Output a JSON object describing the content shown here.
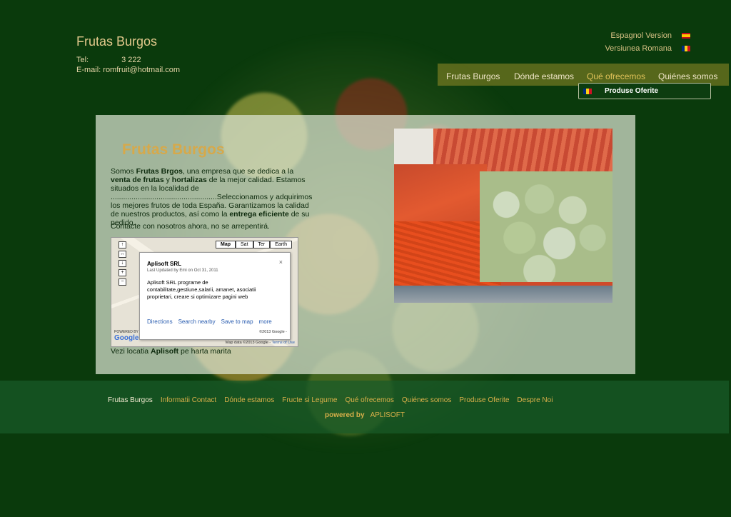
{
  "header": {
    "brand": "Frutas Burgos",
    "tel_label": "Tel:",
    "tel_number": "3 222",
    "email": "E-mail: romfruit@hotmail.com"
  },
  "languages": [
    {
      "label": "Espagnol Version",
      "flag": "spain-flag-icon"
    },
    {
      "label": "Versiunea Romana",
      "flag": "romania-flag-icon"
    }
  ],
  "nav": {
    "items": [
      "Frutas Burgos",
      "Dónde estamos",
      "Qué ofrecemos",
      "Quiénes somos"
    ],
    "active_index": 2,
    "submenu_item": "Produse Oferite"
  },
  "main": {
    "title": "Frutas Burgos",
    "desc_1": "Somos ",
    "desc_brand": "Frutas Brgos",
    "desc_2": ", una empresa  que se dedica a la ",
    "desc_b1": "venta de frutas",
    "desc_3": " y ",
    "desc_b2": "hortalizas",
    "desc_4": " de la mejor calidad. Estamos situados en la localidad de ...................................................Seleccionamos y adquirimos los mejores frutos de toda España. Garantizamos la calidad de nuestros productos, así como la ",
    "desc_b3": "entrega eficiente",
    "desc_5": " de su pedido.",
    "cta": "Contacte con nosotros ahora, no se arrepentirá."
  },
  "map": {
    "buttons": [
      "Map",
      "Sat",
      "Ter",
      "Earth"
    ],
    "info": {
      "title": "Aplisoft SRL",
      "updated": "Last Updated by Emi on Oct 31, 2011",
      "body": "Aplisoft SRL programe de contabilitate,gestiune,salarii, amanet, asociatii proprietari, creare si optimizare pagini web",
      "close": "×",
      "links": [
        "Directions",
        "Search nearby",
        "Save to map",
        "more"
      ],
      "copyright": "©2013 Google -"
    },
    "google_powered": "POWERED BY",
    "google_logo": "Google",
    "credit_text": "Map data ©2013 Google - ",
    "credit_link": "Terms of Use",
    "caption_1": "Vezi locatia ",
    "caption_b": "Aplisoft",
    "caption_2": " pe harta marita"
  },
  "footer": {
    "links": [
      "Frutas Burgos",
      "Informatii Contact",
      "Dónde estamos",
      "Fructe si Legume",
      "Qué ofrecemos",
      "Quiénes somos",
      "Produse Oferite",
      "Despre Noi"
    ],
    "powered_label": "powered by",
    "powered_name": "APLISOFT"
  }
}
